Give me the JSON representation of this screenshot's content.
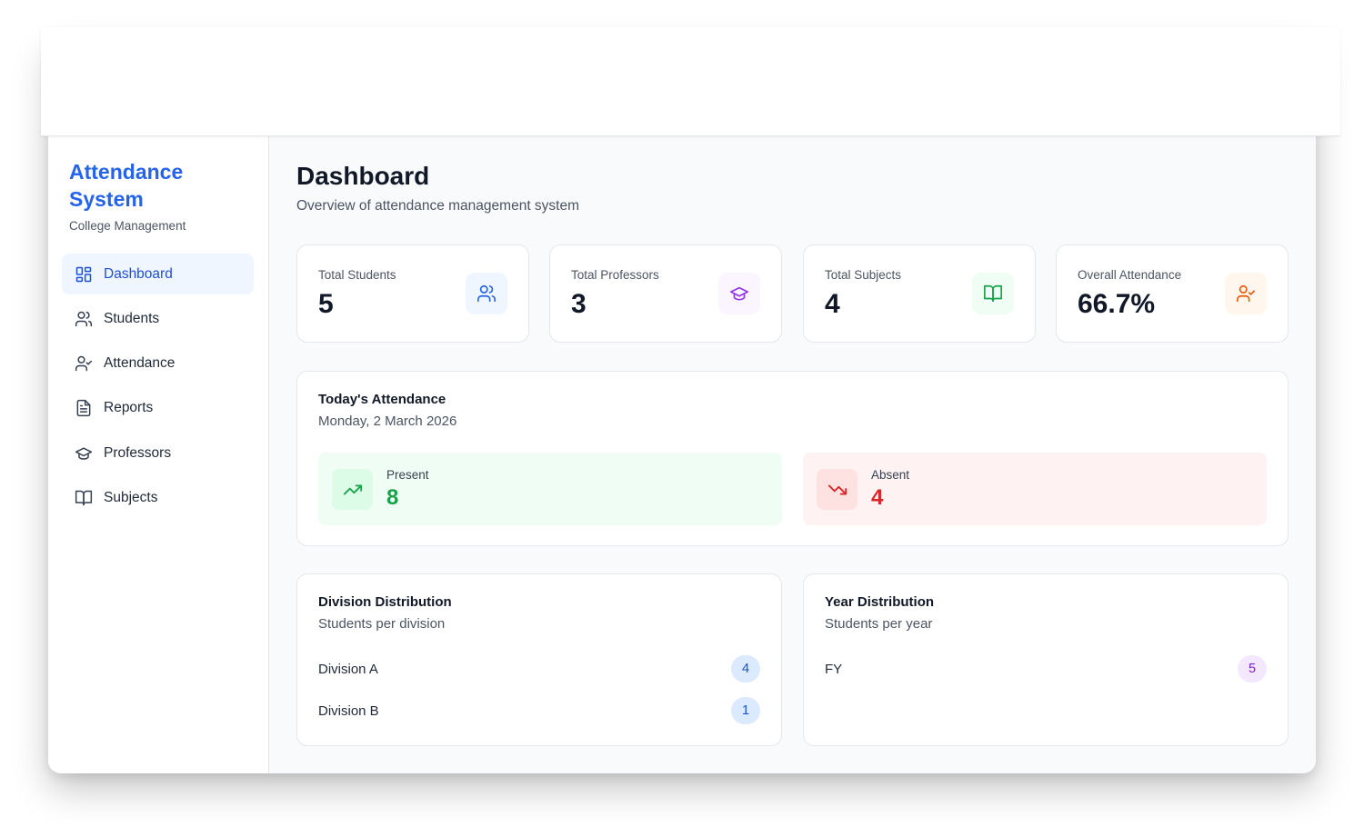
{
  "brand": {
    "title": "Attendance System",
    "subtitle": "College Management",
    "color": "#2563eb"
  },
  "nav": [
    {
      "label": "Dashboard",
      "icon": "grid-icon",
      "active": true
    },
    {
      "label": "Students",
      "icon": "users-icon",
      "active": false
    },
    {
      "label": "Attendance",
      "icon": "user-check-icon",
      "active": false
    },
    {
      "label": "Reports",
      "icon": "file-text-icon",
      "active": false
    },
    {
      "label": "Professors",
      "icon": "graduation-cap-icon",
      "active": false
    },
    {
      "label": "Subjects",
      "icon": "book-open-icon",
      "active": false
    }
  ],
  "header": {
    "title": "Dashboard",
    "subtitle": "Overview of attendance management system"
  },
  "stats": [
    {
      "label": "Total Students",
      "value": "5",
      "icon": "users-icon",
      "color": "#2563eb",
      "bg": "#eff6ff"
    },
    {
      "label": "Total Professors",
      "value": "3",
      "icon": "graduation-cap-icon",
      "color": "#9333ea",
      "bg": "#faf5ff"
    },
    {
      "label": "Total Subjects",
      "value": "4",
      "icon": "book-open-icon",
      "color": "#16a34a",
      "bg": "#f0fdf4"
    },
    {
      "label": "Overall Attendance",
      "value": "66.7%",
      "icon": "user-check-icon",
      "color": "#ea580c",
      "bg": "#fff7ed"
    }
  ],
  "today": {
    "title": "Today's Attendance",
    "date": "Monday, 2 March 2026",
    "present": {
      "label": "Present",
      "value": "8",
      "icon": "trending-up-icon",
      "color": "#16a34a",
      "bg": "#f0fdf4",
      "icon_bg": "#dcfce7"
    },
    "absent": {
      "label": "Absent",
      "value": "4",
      "icon": "trending-down-icon",
      "color": "#dc2626",
      "bg": "#fef2f2",
      "icon_bg": "#fee2e2"
    }
  },
  "division": {
    "title": "Division Distribution",
    "subtitle": "Students per division",
    "rows": [
      {
        "label": "Division A",
        "count": "4"
      },
      {
        "label": "Division B",
        "count": "1"
      }
    ],
    "badge_color": "#1d4ed8",
    "badge_bg": "#dbeafe"
  },
  "year": {
    "title": "Year Distribution",
    "subtitle": "Students per year",
    "rows": [
      {
        "label": "FY",
        "count": "5"
      }
    ],
    "badge_color": "#7e22ce",
    "badge_bg": "#f3e8ff"
  }
}
